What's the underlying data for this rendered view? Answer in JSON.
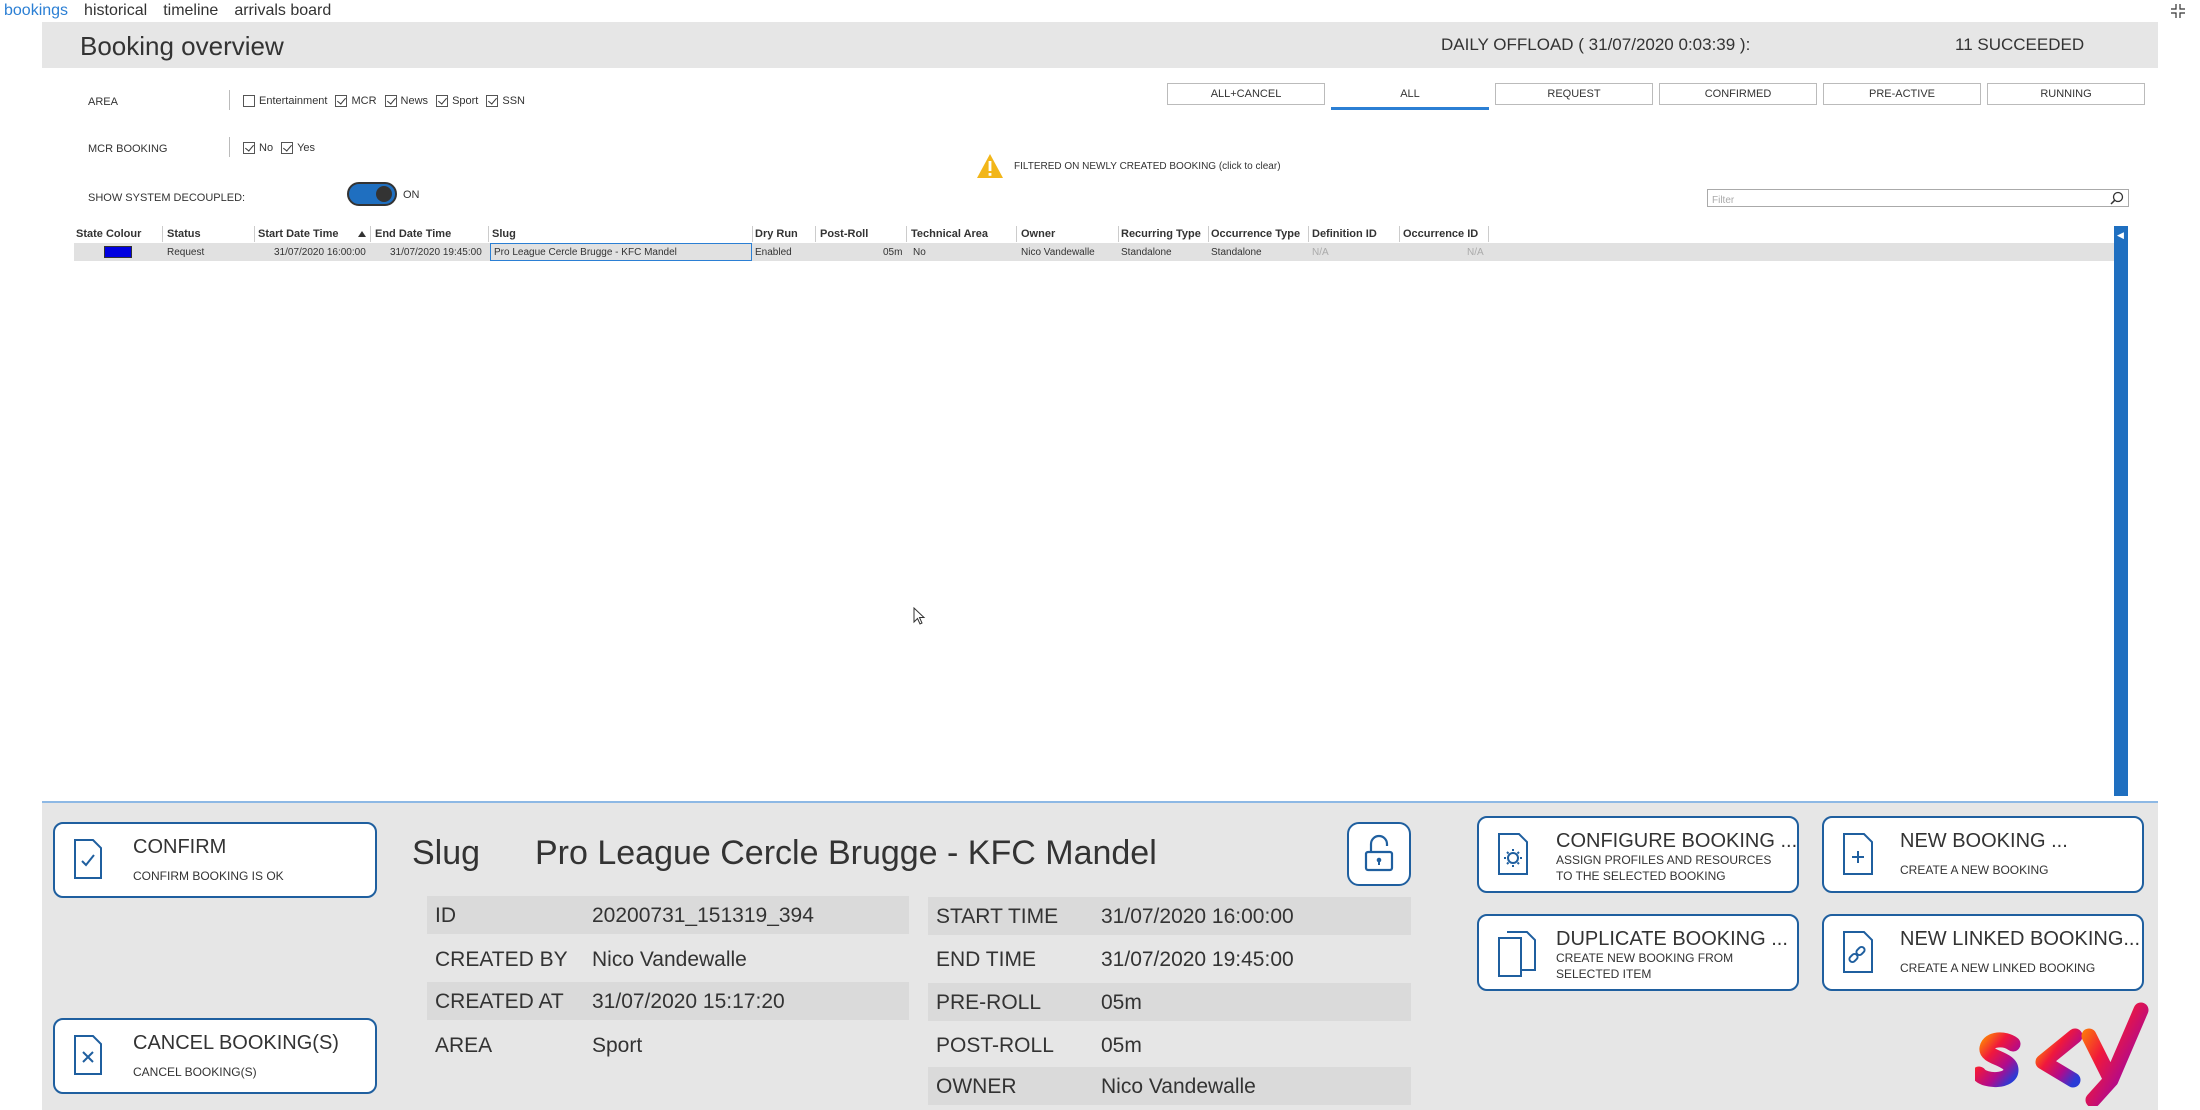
{
  "nav": {
    "tabs": [
      "bookings",
      "historical",
      "timeline",
      "arrivals board"
    ]
  },
  "header": {
    "title": "Booking overview",
    "offload": "DAILY OFFLOAD ( 31/07/2020 0:03:39 ):",
    "succeeded": "11 SUCCEEDED"
  },
  "filters": {
    "area_label": "AREA",
    "area_options": [
      {
        "label": "Entertainment",
        "checked": false
      },
      {
        "label": "MCR",
        "checked": true
      },
      {
        "label": "News",
        "checked": true
      },
      {
        "label": "Sport",
        "checked": true
      },
      {
        "label": "SSN",
        "checked": true
      }
    ],
    "mcr_label": "MCR BOOKING",
    "mcr_options": [
      {
        "label": "No",
        "checked": true
      },
      {
        "label": "Yes",
        "checked": true
      }
    ],
    "decoupled_label": "SHOW SYSTEM DECOUPLED:",
    "decoupled_state": "ON"
  },
  "status_tabs": {
    "items": [
      "ALL+CANCEL",
      "ALL",
      "REQUEST",
      "CONFIRMED",
      "PRE-ACTIVE",
      "RUNNING"
    ],
    "active": "ALL"
  },
  "warning": {
    "text": "FILTERED ON NEWLY CREATED BOOKING (click to clear)"
  },
  "search": {
    "placeholder": "Filter"
  },
  "grid": {
    "columns": [
      "State Colour",
      "Status",
      "Start Date Time",
      "End Date Time",
      "Slug",
      "Dry Run",
      "Post-Roll",
      "Technical Area",
      "Owner",
      "Recurring Type",
      "Occurrence Type",
      "Definition ID",
      "Occurrence ID"
    ],
    "sorted_column": "Start Date Time",
    "rows": [
      {
        "state_colour": "#0000e0",
        "status": "Request",
        "start": "31/07/2020 16:00:00",
        "end": "31/07/2020 19:45:00",
        "slug": "Pro League Cercle Brugge - KFC Mandel",
        "dry_run": "Enabled",
        "post_roll": "05m",
        "technical_area": "No",
        "owner": "Nico Vandewalle",
        "recurring_type": "Standalone",
        "occurrence_type": "Standalone",
        "definition_id": "N/A",
        "occurrence_id": "N/A"
      }
    ]
  },
  "actions": {
    "confirm": {
      "title": "CONFIRM",
      "subtitle": "CONFIRM BOOKING IS OK"
    },
    "cancel": {
      "title": "CANCEL BOOKING(S)",
      "subtitle": "CANCEL BOOKING(S)"
    },
    "configure": {
      "title": "CONFIGURE BOOKING ...",
      "subtitle": "ASSIGN PROFILES AND RESOURCES TO THE SELECTED BOOKING"
    },
    "new": {
      "title": "NEW BOOKING ...",
      "subtitle": "CREATE A NEW BOOKING"
    },
    "duplicate": {
      "title": "DUPLICATE BOOKING ...",
      "subtitle": "CREATE NEW BOOKING FROM SELECTED ITEM"
    },
    "new_linked": {
      "title": "NEW LINKED BOOKING...",
      "subtitle": "CREATE A NEW LINKED BOOKING"
    }
  },
  "detail": {
    "slug_label": "Slug",
    "slug_value": "Pro League Cercle Brugge - KFC Mandel",
    "left": [
      {
        "k": "ID",
        "v": "20200731_151319_394"
      },
      {
        "k": "CREATED BY",
        "v": "Nico Vandewalle"
      },
      {
        "k": "CREATED AT",
        "v": "31/07/2020 15:17:20"
      },
      {
        "k": "AREA",
        "v": "Sport"
      }
    ],
    "right": [
      {
        "k": "START TIME",
        "v": "31/07/2020 16:00:00"
      },
      {
        "k": "END TIME",
        "v": "31/07/2020 19:45:00"
      },
      {
        "k": "PRE-ROLL",
        "v": "05m"
      },
      {
        "k": "POST-ROLL",
        "v": "05m"
      },
      {
        "k": "OWNER",
        "v": "Nico Vandewalle"
      }
    ]
  },
  "brand": {
    "logo_text": "sky"
  },
  "colors": {
    "accent": "#1f6fc0",
    "state_request": "#0000e0",
    "panel": "#e6e6e6"
  }
}
